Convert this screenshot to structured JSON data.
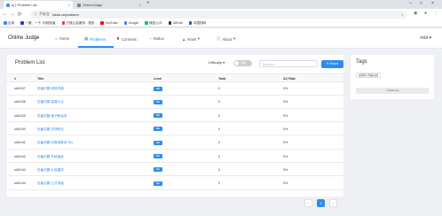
{
  "browser": {
    "tabs": [
      {
        "title": "oj | Problem List",
        "close": "×"
      },
      {
        "title": "OnlineJudge",
        "close": "×"
      }
    ],
    "new_tab": "+",
    "window_controls": [
      "–",
      "□",
      "×"
    ],
    "security_label": "不安全",
    "url": "lckck.cn/problem",
    "bookmarks": [
      {
        "label": "应用",
        "color": "#4285f4"
      },
      {
        "label": "一键、一下, 你就知道",
        "color": "#2932e1"
      },
      {
        "label": "只做公益服务 - 搜查",
        "color": "#e53935"
      },
      {
        "label": "YouTube",
        "color": "#ff0000"
      },
      {
        "label": "Google",
        "color": "#4285f4"
      },
      {
        "label": "微信公众",
        "color": "#07c160"
      },
      {
        "label": "GitHub",
        "color": "#333333"
      },
      {
        "label": "中国知网",
        "color": "#1e5aa8"
      }
    ]
  },
  "app": {
    "brand": "Online Judge",
    "nav": [
      {
        "label": "Home",
        "icon": "home-icon",
        "glyph": "⌂"
      },
      {
        "label": "Problems",
        "icon": "grid-icon",
        "glyph": "▦"
      },
      {
        "label": "Contests",
        "icon": "trophy-icon",
        "glyph": "♜"
      },
      {
        "label": "Status",
        "icon": "status-icon",
        "glyph": "◔"
      },
      {
        "label": "Rank",
        "icon": "rank-icon",
        "glyph": "▲"
      },
      {
        "label": "About",
        "icon": "info-icon",
        "glyph": "ⓘ"
      }
    ],
    "caret": "▾",
    "user": "root",
    "accent": "#2d8cf0"
  },
  "problem_list": {
    "title": "Problem List",
    "difficulty_label": "Difficulty",
    "tags_toggle": "Tags",
    "keyword_placeholder": "Keyword",
    "reset_label": "⟳ Reset",
    "columns": [
      "#",
      "Title",
      "Level",
      "Total",
      "AC Rate"
    ],
    "rows": [
      {
        "id": "old1037",
        "title": "历届试题 网络寻路",
        "level": "Mid",
        "total": "0",
        "ac_rate": "0%"
      },
      {
        "id": "old1038",
        "title": "历届试题 高僧斗法",
        "level": "Mid",
        "total": "0",
        "ac_rate": "0%"
      },
      {
        "id": "old1039",
        "title": "历届试题 格子刷油漆",
        "level": "Mid",
        "total": "0",
        "ac_rate": "0%"
      },
      {
        "id": "old1040",
        "title": "历届试题 农场阳光",
        "level": "Mid",
        "total": "0",
        "ac_rate": "0%"
      },
      {
        "id": "old1041",
        "title": "历届试题 约数倍数选卡片",
        "level": "Mid",
        "total": "0",
        "ac_rate": "0%"
      },
      {
        "id": "old1042",
        "title": "历届试题 车轮轴迹",
        "level": "Mid",
        "total": "0",
        "ac_rate": "0%"
      },
      {
        "id": "old1043",
        "title": "历届试题 九宫重排",
        "level": "Mid",
        "total": "0",
        "ac_rate": "0%"
      },
      {
        "id": "old1044",
        "title": "历届试题 公式求值",
        "level": "Mid",
        "total": "0",
        "ac_rate": "0%"
      }
    ]
  },
  "tags_panel": {
    "title": "Tags",
    "tags": [
      "蓝桥杯-历届试题"
    ],
    "pick_one": "⤮ Pick one"
  },
  "pagination": {
    "prev": "‹",
    "current": "1",
    "next": "›"
  }
}
